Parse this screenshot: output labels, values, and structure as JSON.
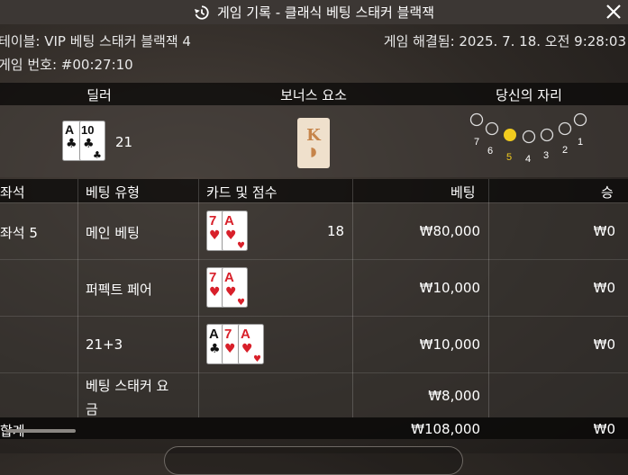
{
  "title": "게임 기록 - 클래식 베팅 스태커 블랙잭",
  "table_label": "테이블: VIP 베팅 스태커 블랙잭 4",
  "resolved_label": "게임 해결됨: 2025. 7. 18. 오전 9:28:03",
  "game_number": "게임 번호: #00:27:10",
  "summary": {
    "dealer_header": "딜러",
    "bonus_header": "보너스 요소",
    "seat_header": "당신의 자리",
    "dealer_cards": [
      "A♣",
      "10♣"
    ],
    "dealer_score": "21",
    "bonus_card": "K",
    "seat_numbers": [
      "7",
      "6",
      "5",
      "4",
      "3",
      "2",
      "1"
    ],
    "active_seat": "5"
  },
  "table": {
    "headers": {
      "seat": "좌석",
      "bet_type": "베팅 유형",
      "cards": "카드 및 점수",
      "bet": "베팅",
      "win": "승"
    },
    "rows": [
      {
        "seat": "좌석 5",
        "bet_type": "메인 베팅",
        "cards": [
          "7♥",
          "A♥"
        ],
        "score": "18",
        "bet": "₩80,000",
        "win": "₩0"
      },
      {
        "seat": "",
        "bet_type": "퍼펙트 페어",
        "cards": [
          "7♥",
          "A♥"
        ],
        "score": "",
        "bet": "₩10,000",
        "win": "₩0"
      },
      {
        "seat": "",
        "bet_type": "21+3",
        "cards": [
          "A♣",
          "7♥",
          "A♥"
        ],
        "score": "",
        "bet": "₩10,000",
        "win": "₩0"
      },
      {
        "seat": "",
        "bet_type_line1": "베팅 스태커 요",
        "bet_type_line2": "금",
        "cards": [],
        "score": "",
        "bet": "₩8,000",
        "win": ""
      }
    ],
    "total": {
      "label": "합계",
      "bet": "₩108,000",
      "win": "₩0"
    }
  },
  "colors": {
    "accent_yellow": "#f2cc1e",
    "heart_red": "#d8202a",
    "club_black": "#111111"
  }
}
